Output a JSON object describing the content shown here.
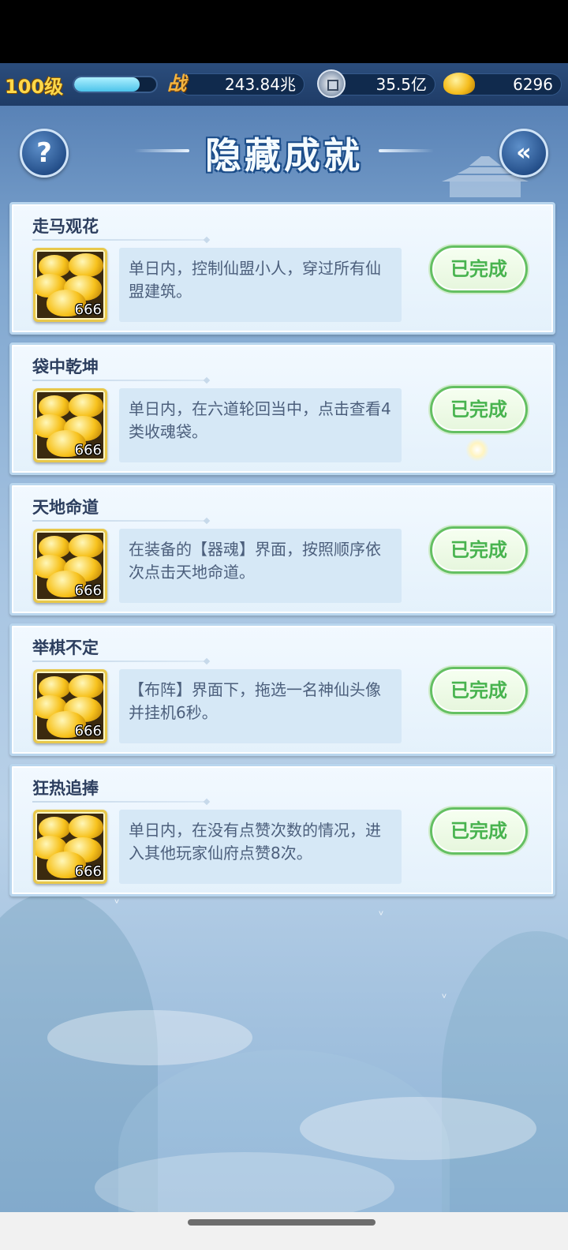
{
  "header": {
    "level": "100级",
    "exp_progress": 0.8,
    "power_value": "243.84兆",
    "power_icon_glyph": "战",
    "coin_value": "35.5亿",
    "gold_value": "6296"
  },
  "page": {
    "title": "隐藏成就",
    "help_glyph": "?",
    "back_glyph": "«"
  },
  "achievements": [
    {
      "name": "走马观花",
      "description": "单日内，控制仙盟小人，穿过所有仙盟建筑。",
      "reward_count": "666",
      "status": "已完成"
    },
    {
      "name": "袋中乾坤",
      "description": "单日内，在六道轮回当中，点击查看4类收魂袋。",
      "reward_count": "666",
      "status": "已完成"
    },
    {
      "name": "天地命道",
      "description": "在装备的【器魂】界面，按照顺序依次点击天地命道。",
      "reward_count": "666",
      "status": "已完成"
    },
    {
      "name": "举棋不定",
      "description": "【布阵】界面下，拖选一名神仙头像并挂机6秒。",
      "reward_count": "666",
      "status": "已完成"
    },
    {
      "name": "狂热追捧",
      "description": "单日内，在没有点赞次数的情况，进入其他玩家仙府点赞8次。",
      "reward_count": "666",
      "status": "已完成"
    }
  ],
  "colors": {
    "completed_green": "#48b34f",
    "level_gold": "#ffd84a",
    "title_outline": "#1d4e8a"
  }
}
